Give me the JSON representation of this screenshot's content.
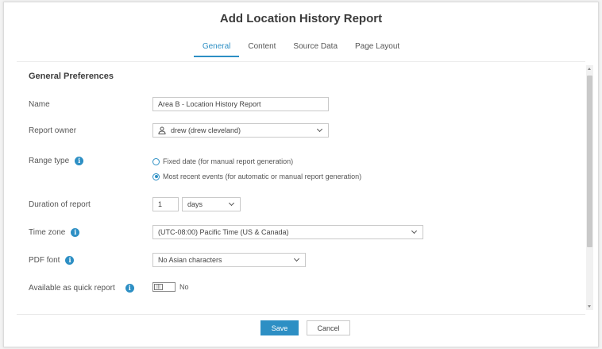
{
  "dialog": {
    "title": "Add Location History Report"
  },
  "tabs": [
    {
      "label": "General",
      "active": true
    },
    {
      "label": "Content",
      "active": false
    },
    {
      "label": "Source Data",
      "active": false
    },
    {
      "label": "Page Layout",
      "active": false
    }
  ],
  "section": {
    "title": "General Preferences"
  },
  "fields": {
    "name": {
      "label": "Name",
      "value": "Area B - Location History Report"
    },
    "report_owner": {
      "label": "Report owner",
      "value": "drew (drew cleveland)"
    },
    "range_type": {
      "label": "Range type",
      "options": [
        {
          "label": "Fixed date (for manual report generation)",
          "selected": false
        },
        {
          "label": "Most recent events (for automatic or manual report generation)",
          "selected": true
        }
      ]
    },
    "duration": {
      "label": "Duration of report",
      "value": "1",
      "unit": "days"
    },
    "time_zone": {
      "label": "Time zone",
      "value": "(UTC-08:00) Pacific Time (US & Canada)"
    },
    "pdf_font": {
      "label": "PDF font",
      "value": "No Asian characters"
    },
    "quick_report": {
      "label": "Available as quick report",
      "state": "No"
    }
  },
  "buttons": {
    "save": "Save",
    "cancel": "Cancel"
  },
  "icons": {
    "info": "info-icon",
    "user": "user-icon",
    "chevron": "chevron-down-icon"
  },
  "colors": {
    "accent": "#2d8fc4",
    "title": "#3b3b3b",
    "border": "#c9c9c9"
  }
}
